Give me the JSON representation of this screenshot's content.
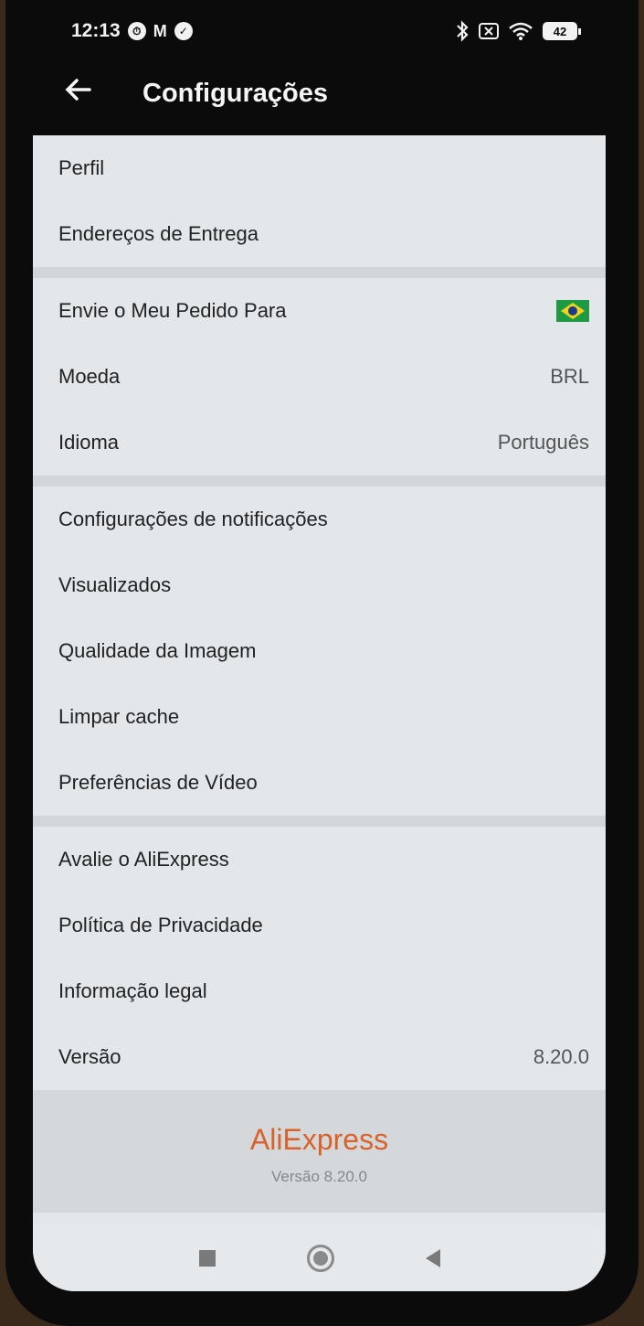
{
  "status_bar": {
    "time": "12:13",
    "left_icons": [
      "clock-icon",
      "gmail-icon",
      "check-icon"
    ],
    "right_icons": [
      "bluetooth-icon",
      "mute-icon",
      "wifi-icon"
    ],
    "battery": "42"
  },
  "app_bar": {
    "title": "Configurações",
    "back_icon": "arrow-left-icon"
  },
  "sections": [
    {
      "items": [
        {
          "label": "Perfil"
        },
        {
          "label": "Endereços de Entrega"
        }
      ]
    },
    {
      "items": [
        {
          "label": "Envie o Meu Pedido Para",
          "value_icon": "brazil-flag-icon"
        },
        {
          "label": "Moeda",
          "value": "BRL"
        },
        {
          "label": "Idioma",
          "value": "Português"
        }
      ]
    },
    {
      "items": [
        {
          "label": "Configurações de notificações"
        },
        {
          "label": "Visualizados"
        },
        {
          "label": "Qualidade da Imagem"
        },
        {
          "label": "Limpar cache"
        },
        {
          "label": "Preferências de Vídeo"
        }
      ]
    },
    {
      "items": [
        {
          "label": "Avalie o AliExpress"
        },
        {
          "label": "Política de Privacidade"
        },
        {
          "label": "Informação legal"
        },
        {
          "label": "Versão",
          "value": "8.20.0"
        }
      ]
    }
  ],
  "footer": {
    "brand": "AliExpress",
    "version": "Versão 8.20.0"
  },
  "nav_bar": {
    "icons": [
      "recent-apps-icon",
      "home-icon",
      "back-icon"
    ]
  },
  "colors": {
    "brand": "#d9612a",
    "background": "#e3e7ea",
    "app_bar": "#0b0b0c"
  }
}
